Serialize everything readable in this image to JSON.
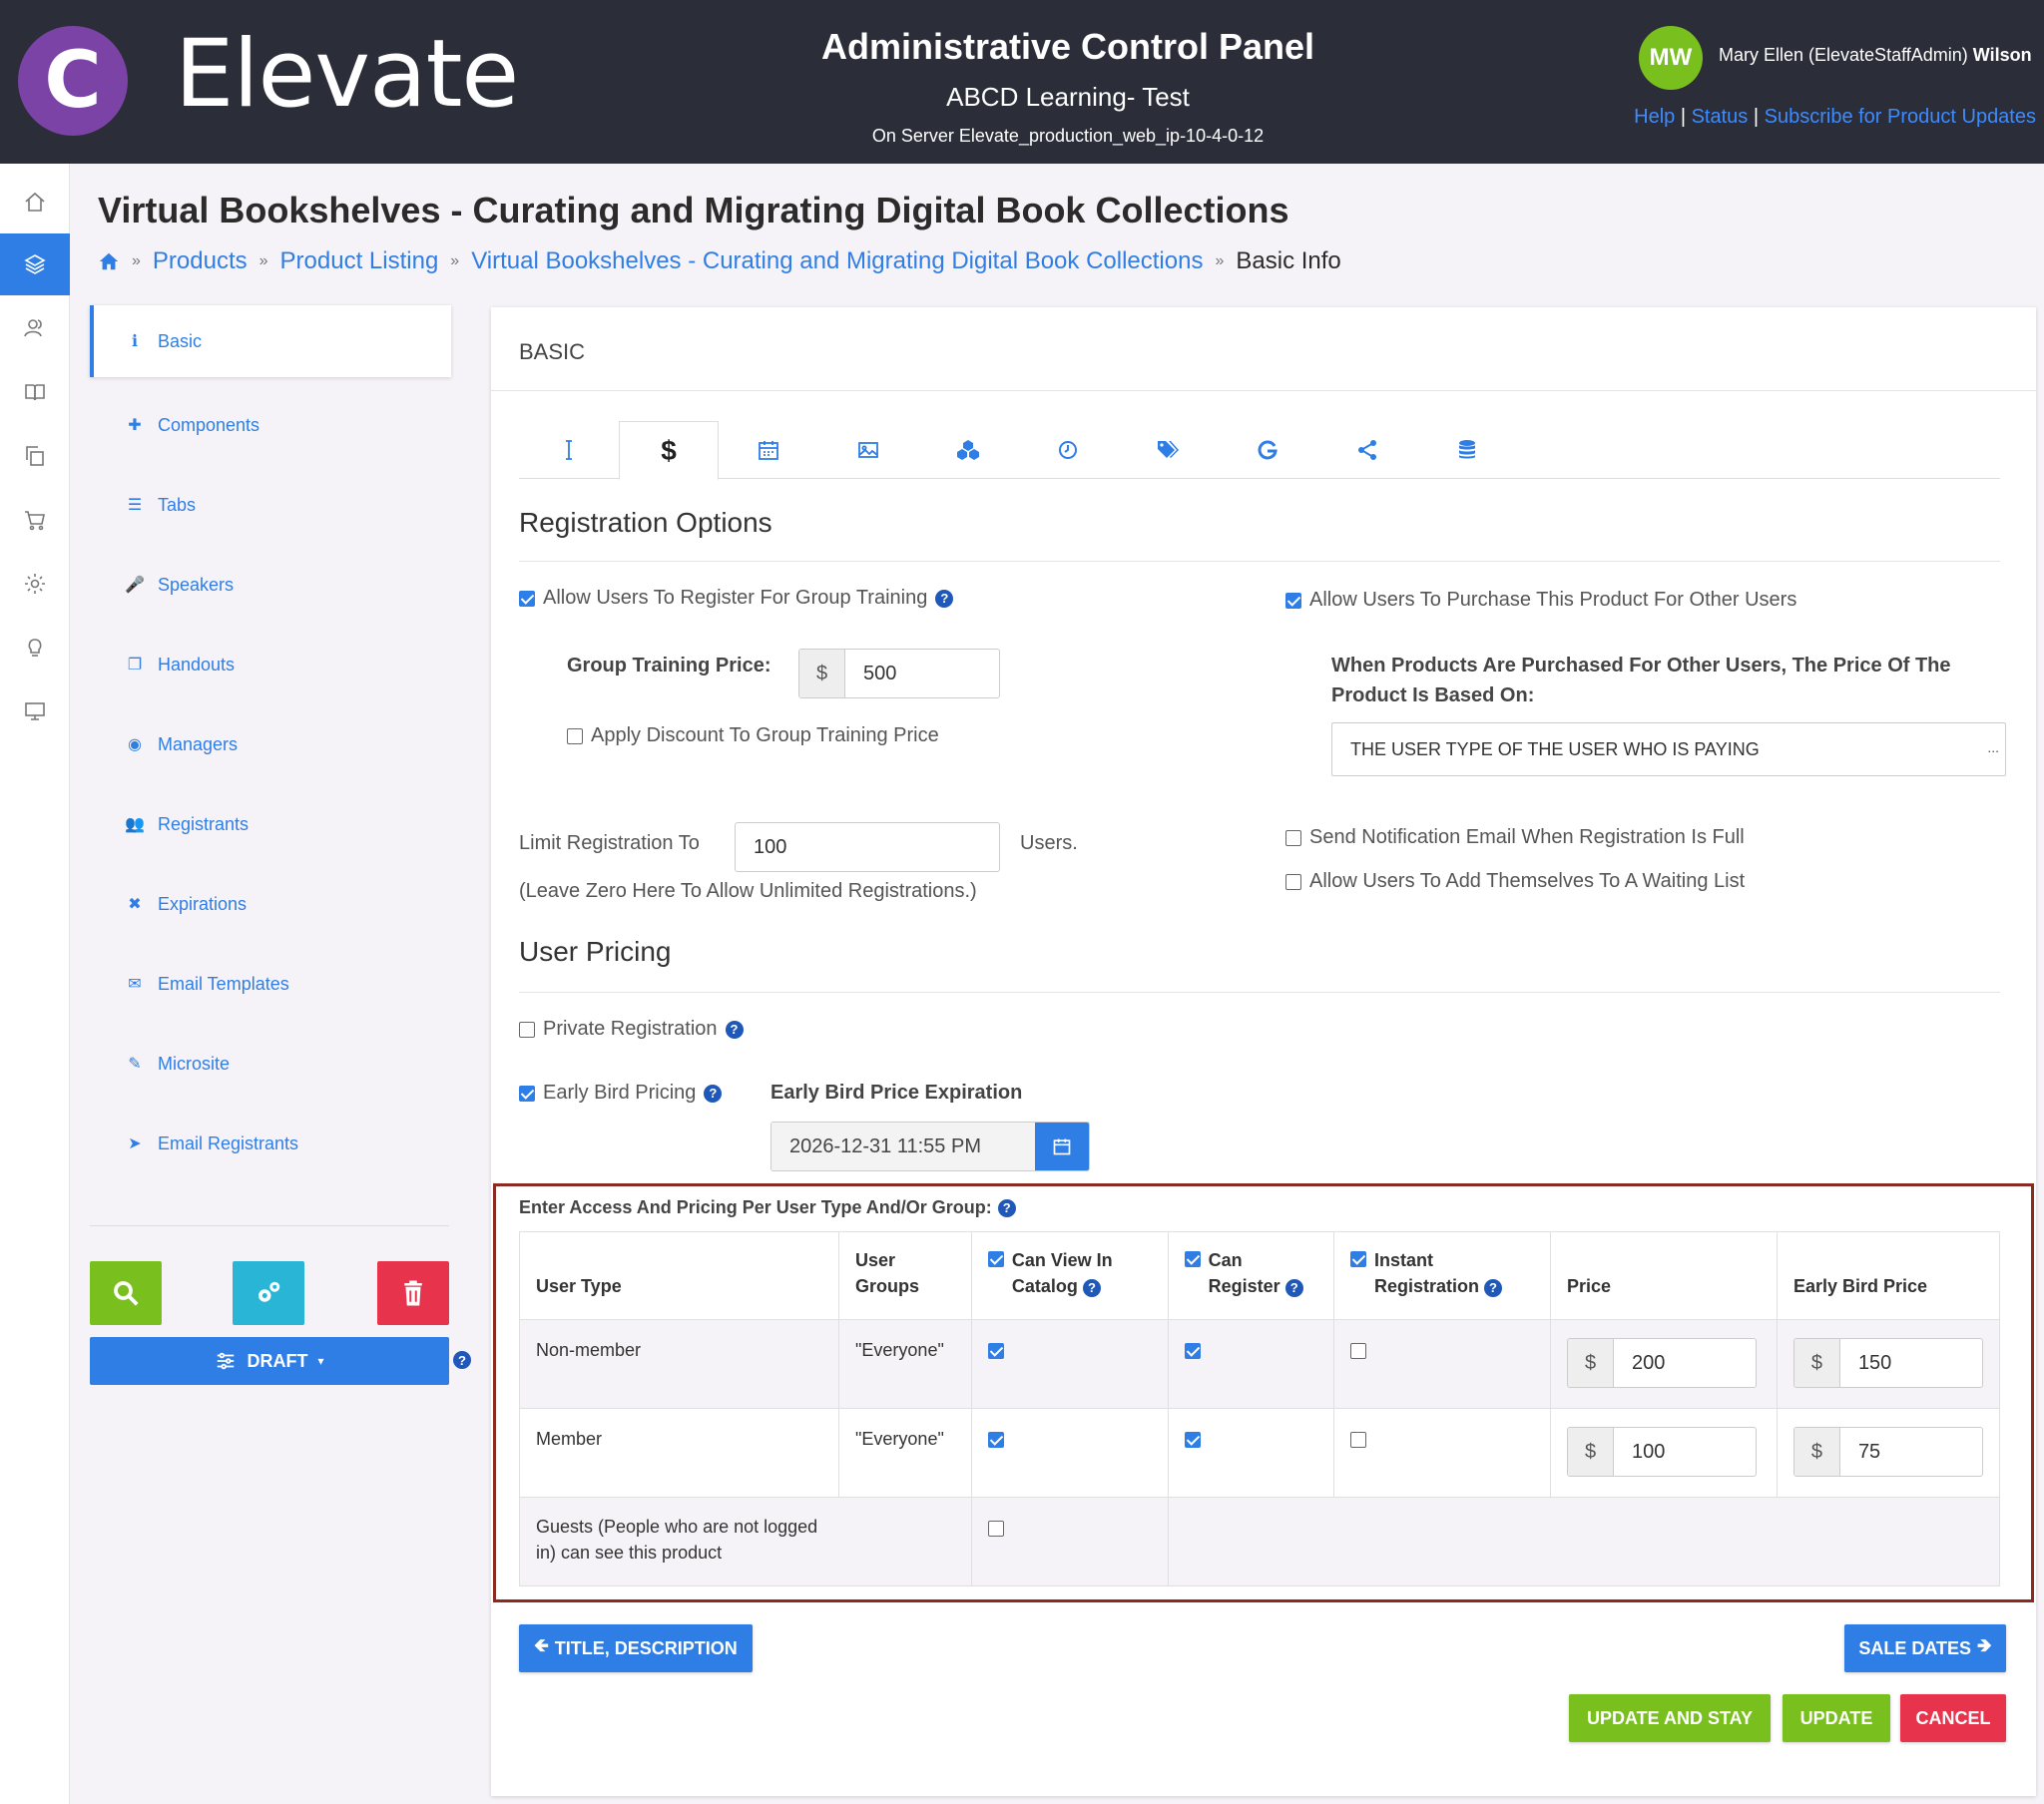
{
  "header": {
    "logo_letter": "C",
    "logo_text": "Elevate",
    "title": "Administrative Control Panel",
    "org": "ABCD Learning- Test",
    "server": "On Server Elevate_production_web_ip-10-4-0-12",
    "avatar_initials": "MW",
    "user_name_prefix": "Mary Ellen (ElevateStaffAdmin)",
    "user_name_last": "Wilson",
    "links": {
      "help": "Help",
      "sep": "|",
      "status": "Status",
      "subscribe": "Subscribe for Product Updates"
    }
  },
  "page": {
    "title": "Virtual Bookshelves - Curating and Migrating Digital Book Collections",
    "breadcrumb": {
      "sep": "»",
      "items": [
        "Products",
        "Product Listing",
        "Virtual Bookshelves - Curating and Migrating Digital Book Collections"
      ],
      "current": "Basic Info"
    }
  },
  "sidenav": {
    "items": [
      {
        "label": "Basic",
        "icon": "info-icon",
        "glyph": "ℹ"
      },
      {
        "label": "Components",
        "icon": "puzzle-icon",
        "glyph": "✚"
      },
      {
        "label": "Tabs",
        "icon": "list-icon",
        "glyph": "☰"
      },
      {
        "label": "Speakers",
        "icon": "microphone-icon",
        "glyph": "🎤"
      },
      {
        "label": "Handouts",
        "icon": "copy-icon",
        "glyph": "❐"
      },
      {
        "label": "Managers",
        "icon": "user-circle-icon",
        "glyph": "◉"
      },
      {
        "label": "Registrants",
        "icon": "users-icon",
        "glyph": "👥"
      },
      {
        "label": "Expirations",
        "icon": "user-times-icon",
        "glyph": "✖"
      },
      {
        "label": "Email Templates",
        "icon": "envelope-icon",
        "glyph": "✉"
      },
      {
        "label": "Microsite",
        "icon": "paintbrush-icon",
        "glyph": "✎"
      },
      {
        "label": "Email Registrants",
        "icon": "paper-plane-icon",
        "glyph": "➤"
      }
    ],
    "draft_label": "DRAFT",
    "help": "?",
    "colors": {
      "search": "#79bf1e",
      "settings": "#29b6d6",
      "delete": "#e8334c"
    }
  },
  "panel": {
    "heading": "BASIC",
    "tabs": [
      "text-cursor-icon",
      "dollar-icon",
      "calendar-icon",
      "image-icon",
      "cubes-icon",
      "clock-icon",
      "tags-icon",
      "google-icon",
      "share-icon",
      "database-icon"
    ],
    "active_tab_glyph": "$",
    "registration": {
      "heading": "Registration Options",
      "group_training": {
        "label": "Allow Users To Register For Group Training",
        "checked": true
      },
      "group_price_label": "Group Training Price:",
      "currency": "$",
      "group_price": "500",
      "apply_discount": {
        "label": "Apply Discount To Group Training Price",
        "checked": false
      },
      "limit_label": "Limit Registration To",
      "limit_value": "100",
      "limit_suffix": "Users.",
      "limit_hint": "(Leave Zero Here To Allow Unlimited Registrations.)",
      "purchase_for_others": {
        "label": "Allow Users To Purchase This Product For Other Users",
        "checked": true
      },
      "price_based_label": "When Products Are Purchased For Other Users, The Price Of The Product Is Based On:",
      "price_based_value": "THE USER TYPE OF THE USER WHO IS PAYING",
      "select_dots": "...",
      "notify_full": {
        "label": "Send Notification Email When Registration Is Full",
        "checked": false
      },
      "waiting_list": {
        "label": "Allow Users To Add Themselves To A Waiting List",
        "checked": false
      }
    },
    "user_pricing": {
      "heading": "User Pricing",
      "private": {
        "label": "Private Registration",
        "checked": false
      },
      "early_bird": {
        "label": "Early Bird Pricing",
        "checked": true
      },
      "early_bird_exp_label": "Early Bird Price Expiration",
      "early_bird_exp_value": "2026-12-31 11:55 PM"
    },
    "pricing_table": {
      "caption": "Enter Access And Pricing Per User Type And/Or Group:",
      "headers": {
        "user_type": "User Type",
        "user_groups_1": "User",
        "user_groups_2": "Groups",
        "can_view_1": "Can View In",
        "can_view_2": "Catalog",
        "can_register_1": "Can",
        "can_register_2": "Register",
        "instant_1": "Instant",
        "instant_2": "Registration",
        "price": "Price",
        "early_bird_price": "Early Bird Price"
      },
      "rows": [
        {
          "user_type": "Non-member",
          "groups": "\"Everyone\"",
          "can_view": true,
          "can_register": true,
          "instant": false,
          "price": "200",
          "early": "150"
        },
        {
          "user_type": "Member",
          "groups": "\"Everyone\"",
          "can_view": true,
          "can_register": true,
          "instant": false,
          "price": "100",
          "early": "75"
        }
      ],
      "guest_row": {
        "label": "Guests (People who are not logged in) can see this product",
        "checked": false
      }
    },
    "buttons": {
      "prev": "TITLE, DESCRIPTION",
      "next": "SALE DATES",
      "update_stay": "UPDATE AND STAY",
      "update": "UPDATE",
      "cancel": "CANCEL"
    }
  }
}
